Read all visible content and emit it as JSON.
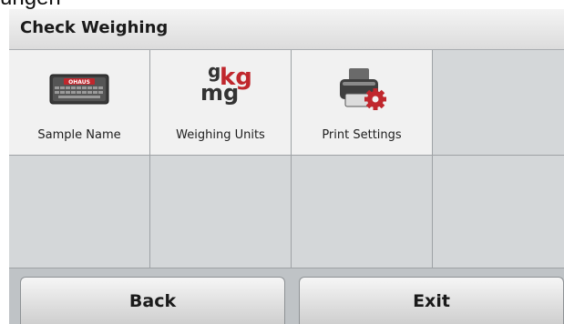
{
  "header": {
    "overflow_text": "ungen",
    "title": "Check Weighing"
  },
  "menu": {
    "items": [
      {
        "label": "Sample Name",
        "icon": "keyboard-icon"
      },
      {
        "label": "Weighing Units",
        "icon": "weighing-units-icon",
        "glyphs": {
          "g": "g",
          "kg": "kg",
          "mg": "mg"
        }
      },
      {
        "label": "Print Settings",
        "icon": "printer-gear-icon"
      }
    ]
  },
  "keyboard": {
    "brand": "OHAUS"
  },
  "footer": {
    "back_label": "Back",
    "exit_label": "Exit"
  },
  "colors": {
    "accent_red": "#c0272d",
    "tile_bg": "#f1f1f1",
    "empty_tile_bg": "#d4d7d9"
  }
}
